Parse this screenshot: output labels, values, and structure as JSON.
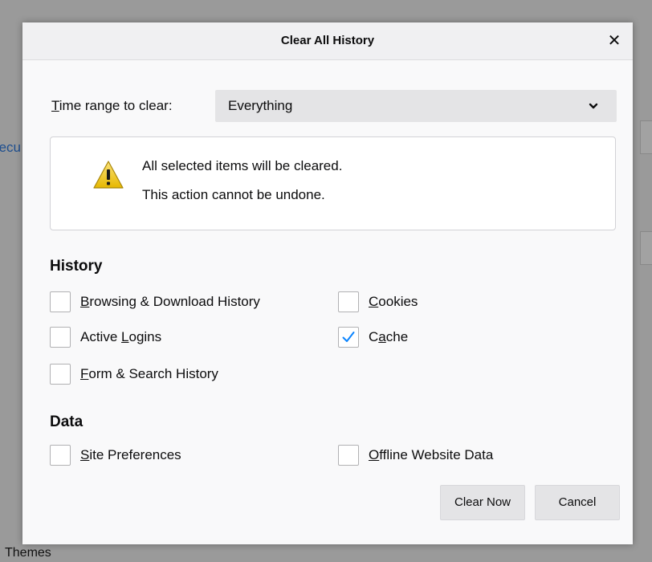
{
  "background": {
    "left_fragment": "ecu",
    "bottom_label": "Themes"
  },
  "dialog": {
    "title": "Clear All History",
    "close_glyph": "✕"
  },
  "time_range": {
    "label_prefix": "",
    "label_underlined": "T",
    "label_rest": "ime range to clear:",
    "selected": "Everything"
  },
  "warning": {
    "icon": "warning-icon",
    "line1": "All selected items will be cleared.",
    "line2": "This action cannot be undone."
  },
  "history": {
    "heading": "History",
    "items": [
      {
        "pre": "",
        "u": "B",
        "post": "rowsing & Download History",
        "checked": false
      },
      {
        "pre": "",
        "u": "C",
        "post": "ookies",
        "checked": false
      },
      {
        "pre": "Active ",
        "u": "L",
        "post": "ogins",
        "checked": false
      },
      {
        "pre": "C",
        "u": "a",
        "post": "che",
        "checked": true
      },
      {
        "pre": "",
        "u": "F",
        "post": "orm & Search History",
        "checked": false
      }
    ]
  },
  "data_section": {
    "heading": "Data",
    "items": [
      {
        "pre": "",
        "u": "S",
        "post": "ite Preferences",
        "checked": false
      },
      {
        "pre": "",
        "u": "O",
        "post": "ffline Website Data",
        "checked": false
      }
    ]
  },
  "buttons": {
    "clear_now": "Clear Now",
    "cancel": "Cancel"
  },
  "colors": {
    "checkmark": "#0a84ff",
    "warning_yellow": "#f5cf1e"
  }
}
